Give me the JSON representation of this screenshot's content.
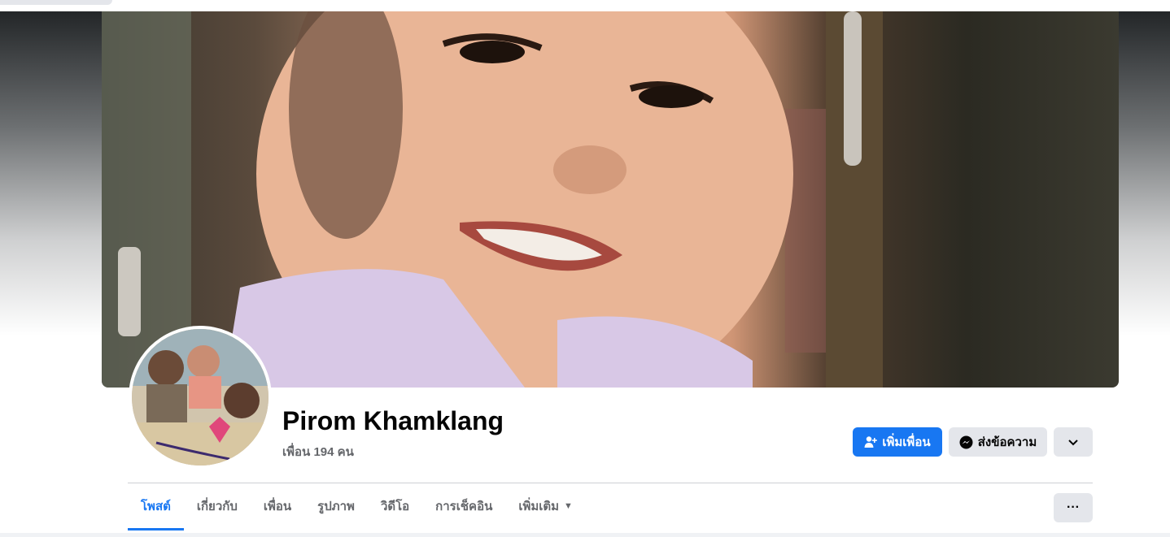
{
  "profile": {
    "name": "Pirom Khamklang",
    "friends_text": "เพื่อน 194 คน"
  },
  "actions": {
    "add_friend_label": "เพิ่มเพื่อน",
    "message_label": "ส่งข้อความ"
  },
  "tabs": [
    {
      "label": "โพสต์",
      "active": true
    },
    {
      "label": "เกี่ยวกับ",
      "active": false
    },
    {
      "label": "เพื่อน",
      "active": false
    },
    {
      "label": "รูปภาพ",
      "active": false
    },
    {
      "label": "วิดีโอ",
      "active": false
    },
    {
      "label": "การเช็คอิน",
      "active": false
    },
    {
      "label": "เพิ่มเติม",
      "active": false
    }
  ],
  "icons": {
    "add_friend": "person-add-icon",
    "message": "messenger-icon",
    "more_actions": "chevron-down-icon",
    "tab_more": "caret-down-icon",
    "overflow": "more-dots-icon"
  },
  "colors": {
    "accent": "#1877f2",
    "secondary_button": "#e4e6eb",
    "text_primary": "#050505",
    "text_secondary": "#65676b"
  }
}
